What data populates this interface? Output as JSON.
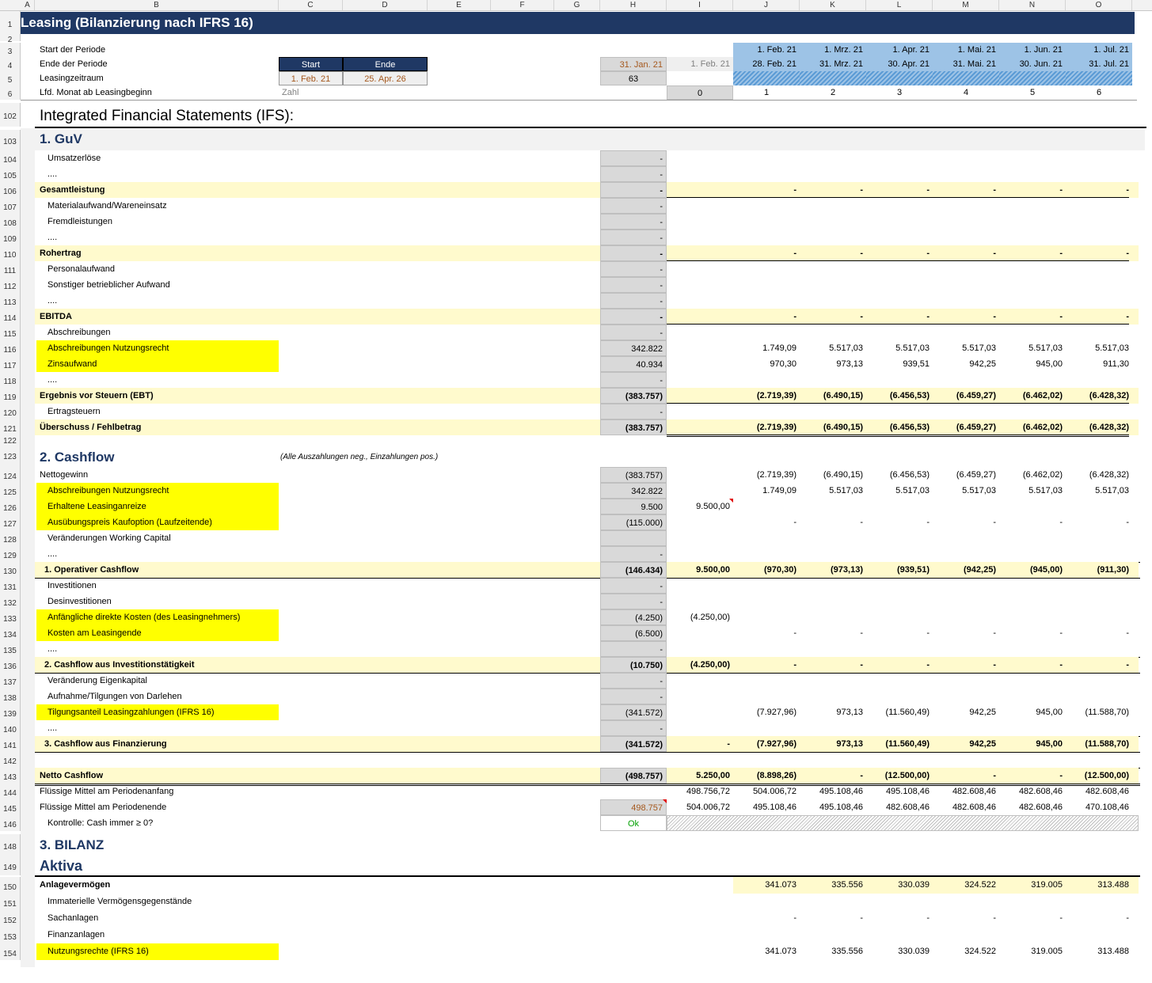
{
  "columns": [
    "A",
    "B",
    "C",
    "D",
    "E",
    "F",
    "G",
    "H",
    "I",
    "J",
    "K",
    "L",
    "M",
    "N",
    "O"
  ],
  "title": "Leasing (Bilanzierung nach IFRS 16)",
  "header_rows": {
    "rownums": [
      "1",
      "2",
      "3",
      "4",
      "5",
      "6"
    ],
    "start_der_periode": "Start der Periode",
    "ende_der_periode": "Ende der Periode",
    "leasingzeitraum": "Leasingzeitraum",
    "lfd_monat": "Lfd. Monat ab Leasingbeginn",
    "start_label": "Start",
    "ende_label": "Ende",
    "start_value": "1. Feb. 21",
    "ende_value": "25. Apr. 26",
    "zahl": "Zahl",
    "h4": "31. Jan. 21",
    "i4": "1. Feb. 21",
    "h5": "63",
    "i6": "0",
    "period_starts": [
      "1. Feb. 21",
      "1. Mrz. 21",
      "1. Apr. 21",
      "1. Mai. 21",
      "1. Jun. 21",
      "1. Jul. 21"
    ],
    "period_ends": [
      "28. Feb. 21",
      "31. Mrz. 21",
      "30. Apr. 21",
      "31. Mai. 21",
      "30. Jun. 21",
      "31. Jul. 21"
    ],
    "months": [
      "1",
      "2",
      "3",
      "4",
      "5",
      "6"
    ]
  },
  "ifs_title": "Integrated Financial Statements (IFS):",
  "ifs_rownum": "102",
  "guv": {
    "title": "1. GuV",
    "rows": [
      {
        "n": "103",
        "label": "",
        "type": "section",
        "h": "",
        "i": "",
        "v": []
      },
      {
        "n": "104",
        "label": "Umsatzerlöse",
        "type": "item",
        "h": "-",
        "i": "",
        "v": []
      },
      {
        "n": "105",
        "label": "....",
        "type": "item",
        "h": "-",
        "i": "",
        "v": []
      },
      {
        "n": "106",
        "label": "Gesamtleistung",
        "type": "total",
        "h": "-",
        "i": "",
        "v": [
          "-",
          "-",
          "-",
          "-",
          "-",
          "-"
        ]
      },
      {
        "n": "107",
        "label": "Materialaufwand/Wareneinsatz",
        "type": "item",
        "h": "-",
        "i": "",
        "v": []
      },
      {
        "n": "108",
        "label": "Fremdleistungen",
        "type": "item",
        "h": "-",
        "i": "",
        "v": []
      },
      {
        "n": "109",
        "label": "....",
        "type": "item",
        "h": "-",
        "i": "",
        "v": []
      },
      {
        "n": "110",
        "label": "Rohertrag",
        "type": "total",
        "h": "-",
        "i": "",
        "v": [
          "-",
          "-",
          "-",
          "-",
          "-",
          "-"
        ]
      },
      {
        "n": "111",
        "label": "Personalaufwand",
        "type": "item",
        "h": "-",
        "i": "",
        "v": []
      },
      {
        "n": "112",
        "label": "Sonstiger betrieblicher Aufwand",
        "type": "item",
        "h": "-",
        "i": "",
        "v": []
      },
      {
        "n": "113",
        "label": "....",
        "type": "item",
        "h": "-",
        "i": "",
        "v": []
      },
      {
        "n": "114",
        "label": "EBITDA",
        "type": "total",
        "h": "-",
        "i": "",
        "v": [
          "-",
          "-",
          "-",
          "-",
          "-",
          "-"
        ]
      },
      {
        "n": "115",
        "label": "Abschreibungen",
        "type": "item",
        "h": "-",
        "i": "",
        "v": []
      },
      {
        "n": "116",
        "label": "Abschreibungen Nutzungsrecht",
        "type": "hl",
        "h": "342.822",
        "i": "",
        "v": [
          "1.749,09",
          "5.517,03",
          "5.517,03",
          "5.517,03",
          "5.517,03",
          "5.517,03"
        ]
      },
      {
        "n": "117",
        "label": "Zinsaufwand",
        "type": "hl",
        "h": "40.934",
        "i": "",
        "v": [
          "970,30",
          "973,13",
          "939,51",
          "942,25",
          "945,00",
          "911,30"
        ]
      },
      {
        "n": "118",
        "label": "....",
        "type": "item",
        "h": "-",
        "i": "",
        "v": []
      },
      {
        "n": "119",
        "label": "Ergebnis vor Steuern (EBT)",
        "type": "total",
        "h": "(383.757)",
        "i": "",
        "v": [
          "(2.719,39)",
          "(6.490,15)",
          "(6.456,53)",
          "(6.459,27)",
          "(6.462,02)",
          "(6.428,32)"
        ]
      },
      {
        "n": "120",
        "label": "Ertragsteuern",
        "type": "item",
        "h": "-",
        "i": "",
        "v": []
      },
      {
        "n": "121",
        "label": "Überschuss / Fehlbetrag",
        "type": "total",
        "h": "(383.757)",
        "i": "",
        "v": [
          "(2.719,39)",
          "(6.490,15)",
          "(6.456,53)",
          "(6.459,27)",
          "(6.462,02)",
          "(6.428,32)"
        ]
      }
    ]
  },
  "cashflow": {
    "title": "2. Cashflow",
    "note": "(Alle Auszahlungen neg., Einzahlungen pos.)",
    "rows": [
      {
        "n": "124",
        "label": "Nettogewinn",
        "type": "plain",
        "h": "(383.757)",
        "i": "",
        "v": [
          "(2.719,39)",
          "(6.490,15)",
          "(6.456,53)",
          "(6.459,27)",
          "(6.462,02)",
          "(6.428,32)"
        ]
      },
      {
        "n": "125",
        "label": "Abschreibungen Nutzungsrecht",
        "type": "hl",
        "h": "342.822",
        "i": "",
        "v": [
          "1.749,09",
          "5.517,03",
          "5.517,03",
          "5.517,03",
          "5.517,03",
          "5.517,03"
        ]
      },
      {
        "n": "126",
        "label": "Erhaltene Leasinganreize",
        "type": "hl",
        "h": "9.500",
        "i": "9.500,00",
        "v": []
      },
      {
        "n": "127",
        "label": "Ausübungspreis Kaufoption (Laufzeitende)",
        "type": "hl",
        "h": "(115.000)",
        "i": "",
        "v": [
          "-",
          "-",
          "-",
          "-",
          "-",
          "-"
        ]
      },
      {
        "n": "128",
        "label": "Veränderungen Working Capital",
        "type": "item",
        "h": "",
        "i": "",
        "v": []
      },
      {
        "n": "129",
        "label": "....",
        "type": "item",
        "h": "-",
        "i": "",
        "v": []
      },
      {
        "n": "130",
        "label": "1. Operativer Cashflow",
        "type": "cftotal",
        "h": "(146.434)",
        "i": "9.500,00",
        "v": [
          "(970,30)",
          "(973,13)",
          "(939,51)",
          "(942,25)",
          "(945,00)",
          "(911,30)"
        ]
      },
      {
        "n": "131",
        "label": "Investitionen",
        "type": "item",
        "h": "-",
        "i": "",
        "v": []
      },
      {
        "n": "132",
        "label": "Desinvestitionen",
        "type": "item",
        "h": "-",
        "i": "",
        "v": []
      },
      {
        "n": "133",
        "label": "Anfängliche direkte Kosten (des Leasingnehmers)",
        "type": "hl",
        "h": "(4.250)",
        "i": "(4.250,00)",
        "v": []
      },
      {
        "n": "134",
        "label": "Kosten am Leasingende",
        "type": "hl",
        "h": "(6.500)",
        "i": "",
        "v": [
          "-",
          "-",
          "-",
          "-",
          "-",
          "-"
        ]
      },
      {
        "n": "135",
        "label": "....",
        "type": "item",
        "h": "-",
        "i": "",
        "v": []
      },
      {
        "n": "136",
        "label": "2. Cashflow aus Investitionstätigkeit",
        "type": "cftotal",
        "h": "(10.750)",
        "i": "(4.250,00)",
        "v": [
          "-",
          "-",
          "-",
          "-",
          "-",
          "-"
        ]
      },
      {
        "n": "137",
        "label": "Veränderung Eigenkapital",
        "type": "item",
        "h": "-",
        "i": "",
        "v": []
      },
      {
        "n": "138",
        "label": "Aufnahme/Tilgungen von Darlehen",
        "type": "item",
        "h": "-",
        "i": "",
        "v": []
      },
      {
        "n": "139",
        "label": "Tilgungsanteil Leasingzahlungen (IFRS 16)",
        "type": "hl",
        "h": "(341.572)",
        "i": "",
        "v": [
          "(7.927,96)",
          "973,13",
          "(11.560,49)",
          "942,25",
          "945,00",
          "(11.588,70)"
        ]
      },
      {
        "n": "140",
        "label": "....",
        "type": "item",
        "h": "-",
        "i": "",
        "v": []
      },
      {
        "n": "141",
        "label": "3. Cashflow aus Finanzierung",
        "type": "cftotal",
        "h": "(341.572)",
        "i": "-",
        "v": [
          "(7.927,96)",
          "973,13",
          "(11.560,49)",
          "942,25",
          "945,00",
          "(11.588,70)"
        ]
      },
      {
        "n": "142",
        "label": "",
        "type": "blank",
        "h": "",
        "i": "",
        "v": []
      },
      {
        "n": "143",
        "label": "Netto Cashflow",
        "type": "net",
        "h": "(498.757)",
        "i": "5.250,00",
        "v": [
          "(8.898,26)",
          "-",
          "(12.500,00)",
          "-",
          "-",
          "(12.500,00)"
        ]
      },
      {
        "n": "144",
        "label": "Flüssige Mittel am Periodenanfang",
        "type": "plain2",
        "h": "",
        "i": "498.756,72",
        "v": [
          "504.006,72",
          "495.108,46",
          "495.108,46",
          "482.608,46",
          "482.608,46",
          "482.608,46"
        ]
      },
      {
        "n": "145",
        "label": "Flüssige Mittel am Periodenende",
        "type": "plain2",
        "h": "498.757",
        "i": "504.006,72",
        "v": [
          "495.108,46",
          "495.108,46",
          "482.608,46",
          "482.608,46",
          "482.608,46",
          "470.108,46"
        ]
      },
      {
        "n": "146",
        "label": "Kontrolle: Cash immer ≥ 0?",
        "type": "check",
        "h": "Ok",
        "i": "",
        "v": []
      }
    ]
  },
  "bilanz": {
    "title": "3. BILANZ",
    "title_rownum": "148",
    "aktiva": "Aktiva",
    "aktiva_rownum": "149",
    "rows": [
      {
        "n": "150",
        "label": "Anlagevermögen",
        "type": "bilanztotal",
        "v": [
          "341.073",
          "335.556",
          "330.039",
          "324.522",
          "319.005",
          "313.488"
        ]
      },
      {
        "n": "151",
        "label": "Immaterielle Vermögensgegenstände",
        "type": "item",
        "v": []
      },
      {
        "n": "152",
        "label": "Sachanlagen",
        "type": "item",
        "v": [
          "-",
          "-",
          "-",
          "-",
          "-",
          "-"
        ]
      },
      {
        "n": "153",
        "label": "Finanzanlagen",
        "type": "item",
        "v": []
      },
      {
        "n": "154",
        "label": "Nutzungsrechte (IFRS 16)",
        "type": "hl",
        "v": [
          "341.073",
          "335.556",
          "330.039",
          "324.522",
          "319.005",
          "313.488"
        ]
      }
    ]
  }
}
